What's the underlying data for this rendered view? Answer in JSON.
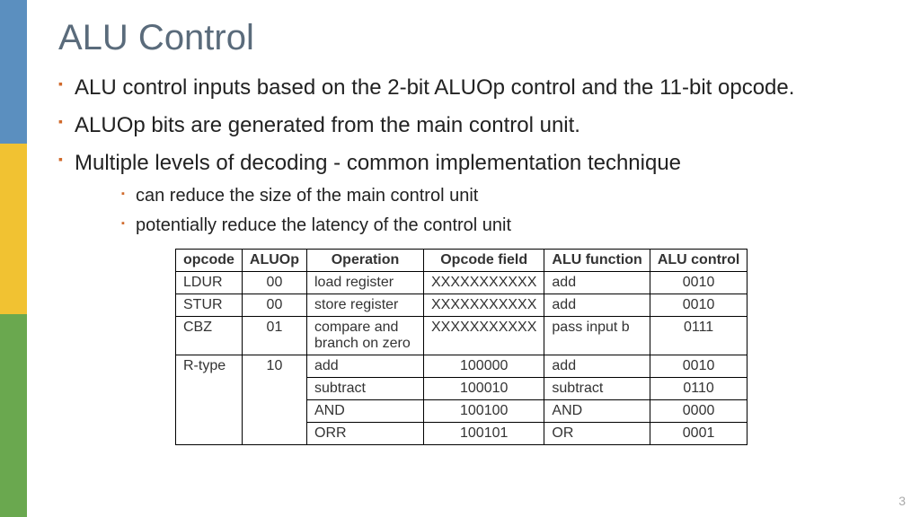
{
  "title": "ALU Control",
  "bullets": {
    "b1": "ALU control inputs based on the 2-bit ALUOp control and the 11-bit opcode.",
    "b2": "ALUOp bits are generated from the main control unit.",
    "b3": "Multiple levels of decoding - common implementation technique",
    "s1": "can reduce the size of the main control unit",
    "s2": "potentially reduce the latency of the control unit"
  },
  "headers": {
    "h0": "opcode",
    "h1": "ALUOp",
    "h2": "Operation",
    "h3": "Opcode field",
    "h4": "ALU function",
    "h5": "ALU control"
  },
  "rows": [
    {
      "opcode": "LDUR",
      "aluop": "00",
      "operation": "load register",
      "field": "XXXXXXXXXXX",
      "func": "add",
      "ctrl": "0010"
    },
    {
      "opcode": "STUR",
      "aluop": "00",
      "operation": "store register",
      "field": "XXXXXXXXXXX",
      "func": "add",
      "ctrl": "0010"
    },
    {
      "opcode": "CBZ",
      "aluop": "01",
      "operation": "compare and branch on zero",
      "field": "XXXXXXXXXXX",
      "func": "pass input b",
      "ctrl": "0111"
    },
    {
      "opcode": "R-type",
      "aluop": "10",
      "operation": "add",
      "field": "100000",
      "func": "add",
      "ctrl": "0010"
    },
    {
      "opcode": "",
      "aluop": "",
      "operation": "subtract",
      "field": "100010",
      "func": "subtract",
      "ctrl": "0110"
    },
    {
      "opcode": "",
      "aluop": "",
      "operation": "AND",
      "field": "100100",
      "func": "AND",
      "ctrl": "0000"
    },
    {
      "opcode": "",
      "aluop": "",
      "operation": "ORR",
      "field": "100101",
      "func": "OR",
      "ctrl": "0001"
    }
  ],
  "pagenum": "3"
}
